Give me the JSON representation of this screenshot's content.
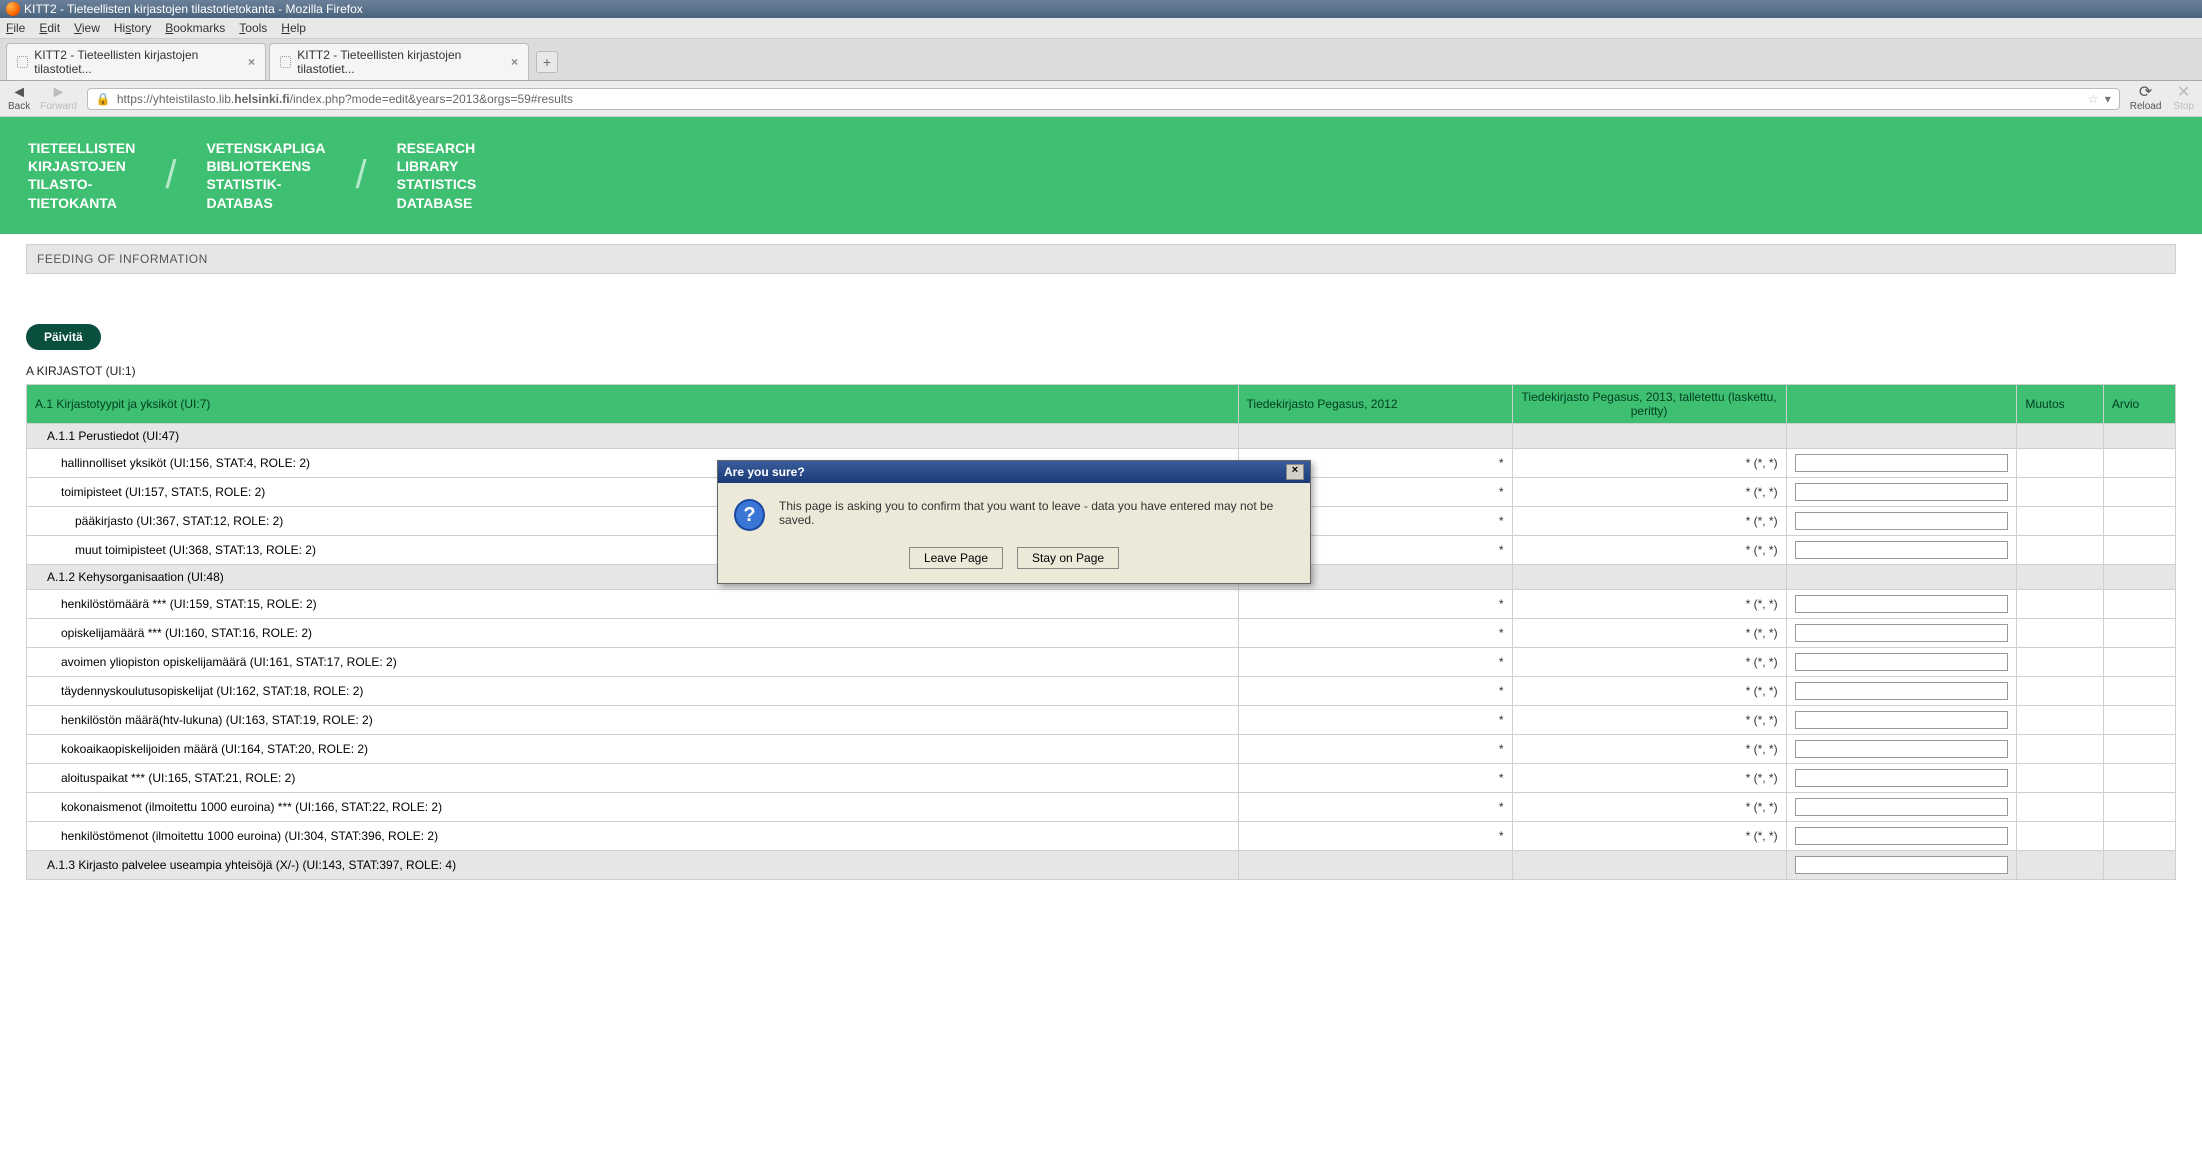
{
  "window": {
    "title": "KITT2 - Tieteellisten kirjastojen tilastotietokanta - Mozilla Firefox"
  },
  "menu": {
    "file": "File",
    "edit": "Edit",
    "view": "View",
    "history": "History",
    "bookmarks": "Bookmarks",
    "tools": "Tools",
    "help": "Help"
  },
  "tabs": {
    "t1": "KITT2 - Tieteellisten kirjastojen tilastotiet...",
    "t2": "KITT2 - Tieteellisten kirjastojen tilastotiet...",
    "close": "×",
    "add": "+"
  },
  "nav": {
    "back": "Back",
    "forward": "Forward",
    "reload": "Reload",
    "stop": "Stop",
    "url_prefix": "https://yhteistilasto.lib.",
    "url_bold": "helsinki.fi",
    "url_rest": "/index.php?mode=edit&years=2013&orgs=59#results"
  },
  "banner": {
    "col1": "TIETEELLISTEN\nKIRJASTOJEN\nTILASTO-\nTIETOKANTA",
    "col2": "VETENSKAPLIGA\nBIBLIOTEKENS\nSTATISTIK-\nDATABAS",
    "col3": "RESEARCH\nLIBRARY\nSTATISTICS\nDATABASE"
  },
  "feedbar": "FEEDING OF INFORMATION",
  "update_btn": "Päivitä",
  "section": "A KIRJASTOT (UI:1)",
  "headers": {
    "label": "A.1 Kirjastotyypit ja yksiköt (UI:7)",
    "y1": "Tiedekirjasto Pegasus, 2012",
    "y2": "Tiedekirjasto Pegasus, 2013, talletettu (laskettu, peritty)",
    "mutos": "Muutos",
    "arvio": "Arvio"
  },
  "val_star": "*",
  "val_star_pair": "* (*, *)",
  "rows": {
    "sub1": "A.1.1 Perustiedot (UI:47)",
    "r1": "hallinnolliset yksiköt (UI:156, STAT:4, ROLE: 2)",
    "r2": "toimipisteet (UI:157, STAT:5, ROLE: 2)",
    "r3": "pääkirjasto (UI:367, STAT:12, ROLE: 2)",
    "r4": "muut toimipisteet (UI:368, STAT:13, ROLE: 2)",
    "sub2": "A.1.2 Kehysorganisaation (UI:48)",
    "r5": "henkilöstömäärä *** (UI:159, STAT:15, ROLE: 2)",
    "r6": "opiskelijamäärä *** (UI:160, STAT:16, ROLE: 2)",
    "r7": "avoimen yliopiston opiskelijamäärä (UI:161, STAT:17, ROLE: 2)",
    "r8": "täydennyskoulutusopiskelijat (UI:162, STAT:18, ROLE: 2)",
    "r9": "henkilöstön määrä(htv-lukuna) (UI:163, STAT:19, ROLE: 2)",
    "r10": "kokoaikaopiskelijoiden määrä (UI:164, STAT:20, ROLE: 2)",
    "r11": "aloituspaikat *** (UI:165, STAT:21, ROLE: 2)",
    "r12": "kokonaismenot (ilmoitettu 1000 euroina) *** (UI:166, STAT:22, ROLE: 2)",
    "r13": "henkilöstömenot (ilmoitettu 1000 euroina) (UI:304, STAT:396, ROLE: 2)",
    "sub3": "A.1.3 Kirjasto palvelee useampia yhteisöjä (X/-) (UI:143, STAT:397, ROLE: 4)"
  },
  "dialog": {
    "title": "Are you sure?",
    "msg": "This page is asking you to confirm that you want to leave - data you have entered may not be saved.",
    "leave": "Leave Page",
    "stay": "Stay on Page",
    "close": "×",
    "icon": "?"
  }
}
